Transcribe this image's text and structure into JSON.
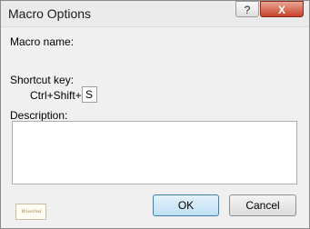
{
  "window": {
    "title": "Macro Options",
    "help_label": "?",
    "close_label": "X"
  },
  "form": {
    "macro_name_label": "Macro name:",
    "shortcut_key_label": "Shortcut key:",
    "modifier_label": "Ctrl+Shift+",
    "shortcut_value": "S",
    "description_label": "Description:",
    "description_value": ""
  },
  "logo": {
    "name": "logo-icon",
    "text": "WiseOwl"
  },
  "buttons": {
    "ok_label": "OK",
    "cancel_label": "Cancel"
  }
}
